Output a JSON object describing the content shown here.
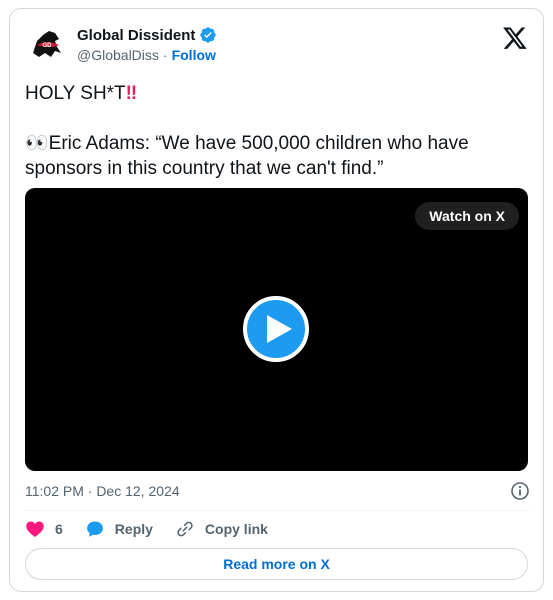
{
  "author": {
    "display_name": "Global Dissident",
    "handle": "@GlobalDiss",
    "separator": "·",
    "follow_label": "Follow",
    "avatar_icon": "horse-logo-icon",
    "verified_icon": "verified-badge-icon"
  },
  "platform": {
    "logo_icon": "x-logo-icon"
  },
  "tweet": {
    "line1": "HOLY SH*T",
    "line1_emoji": "‼",
    "line2_emoji": "👀",
    "line2": "Eric Adams: “We have 500,000 children who have",
    "line3": "sponsors in this country that we can't find.”"
  },
  "video": {
    "watch_label": "Watch on X",
    "play_icon": "play-icon"
  },
  "meta": {
    "timestamp": "11:02 PM · Dec 12, 2024",
    "info_icon": "info-icon"
  },
  "actions": {
    "like_count": "6",
    "reply_label": "Reply",
    "copy_label": "Copy link"
  },
  "footer": {
    "read_more_label": "Read more on X"
  },
  "colors": {
    "accent": "#1d9bf0",
    "link": "#006fd6",
    "like": "#f91880",
    "muted": "#536471",
    "border": "#cfd9de"
  }
}
